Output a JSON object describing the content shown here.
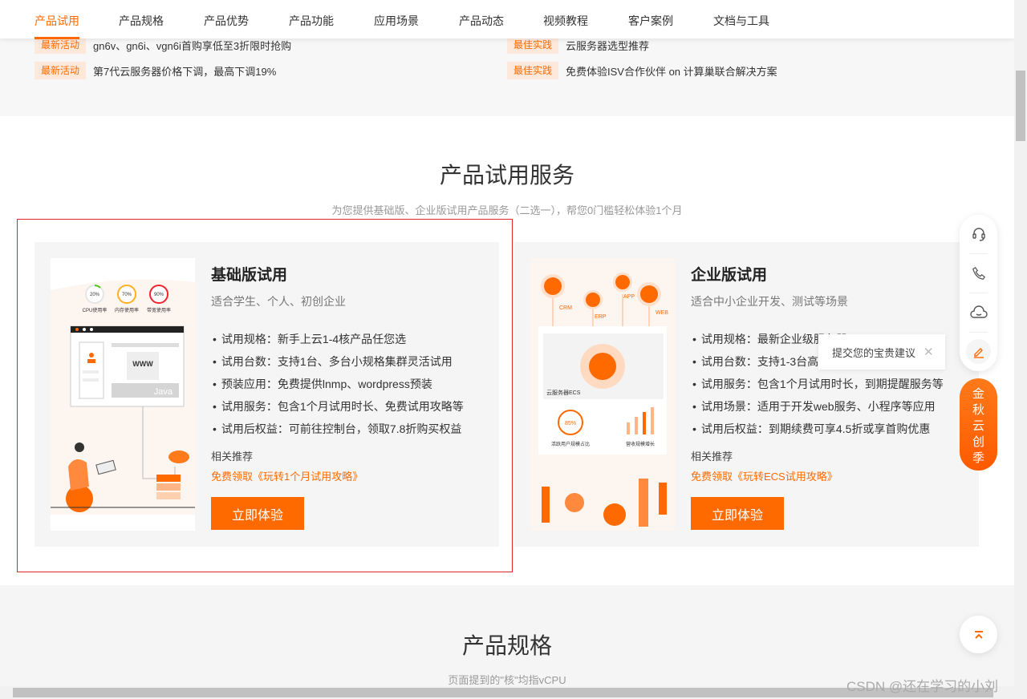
{
  "nav": {
    "items": [
      "产品试用",
      "产品规格",
      "产品优势",
      "产品功能",
      "应用场景",
      "产品动态",
      "视频教程",
      "客户案例",
      "文档与工具"
    ],
    "active": 0
  },
  "news": [
    {
      "badge": "最新活动",
      "text": "gn6v、gn6i、vgn6i首购享低至3折限时抢购"
    },
    {
      "badge": "最佳实践",
      "text": "云服务器选型推荐"
    },
    {
      "badge": "最新活动",
      "text": "第7代云服务器价格下调，最高下调19%"
    },
    {
      "badge": "最佳实践",
      "text": "免费体验ISV合作伙伴 on 计算巢联合解决方案"
    }
  ],
  "trial": {
    "title": "产品试用服务",
    "subtitle": "为您提供基础版、企业版试用产品服务（二选一），帮您0门槛轻松体验1个月"
  },
  "cards": [
    {
      "title": "基础版试用",
      "subtitle": "适合学生、个人、初创企业",
      "bullets": [
        "试用规格：新手上云1-4核产品任您选",
        "试用台数：支持1台、多台小规格集群灵活试用",
        "预装应用：免费提供lnmp、wordpress预装",
        "试用服务：包含1个月试用时长、免费试用攻略等",
        "试用后权益：可前往控制台，领取7.8折购买权益"
      ],
      "related": "相关推荐",
      "link": "免费领取《玩转1个月试用攻略》",
      "button": "立即体验",
      "illus": {
        "gauges": [
          {
            "value": "20%",
            "label": "CPU使用率"
          },
          {
            "value": "70%",
            "label": "内存使用率"
          },
          {
            "value": "90%",
            "label": "带宽使用率"
          }
        ],
        "www": "WWW",
        "java": "Java"
      }
    },
    {
      "title": "企业版试用",
      "subtitle": "适合中小企业开发、测试等场景",
      "bullets": [
        "试用规格：最新企业级服务器",
        "试用台数：支持1-3台高配服务器",
        "试用服务：包含1个月试用时长，到期提醒服务等",
        "试用场景：适用于开发web服务、小程序等应用",
        "试用后权益：到期续费可享4.5折或享首购优惠"
      ],
      "related": "相关推荐",
      "link": "免费领取《玩转ECS试用攻略》",
      "button": "立即体验",
      "illus": {
        "nodes": [
          "CRM",
          "ERP",
          "APP",
          "WEB"
        ],
        "center": "云服务器ECS",
        "stat1": "85%",
        "stat1_label": "活跃用户规模占比",
        "stat2_label": "营收规模增长"
      }
    }
  ],
  "spec": {
    "title": "产品规格",
    "subtitle": "页面提到的\"核\"均指vCPU"
  },
  "float": {
    "tooltip": "提交您的宝贵建议",
    "promo": "金秋云创季"
  },
  "watermark": "CSDN @还在学习的小刘",
  "colors": {
    "accent": "#ff6a00",
    "highlight_border": "#e0262b"
  }
}
